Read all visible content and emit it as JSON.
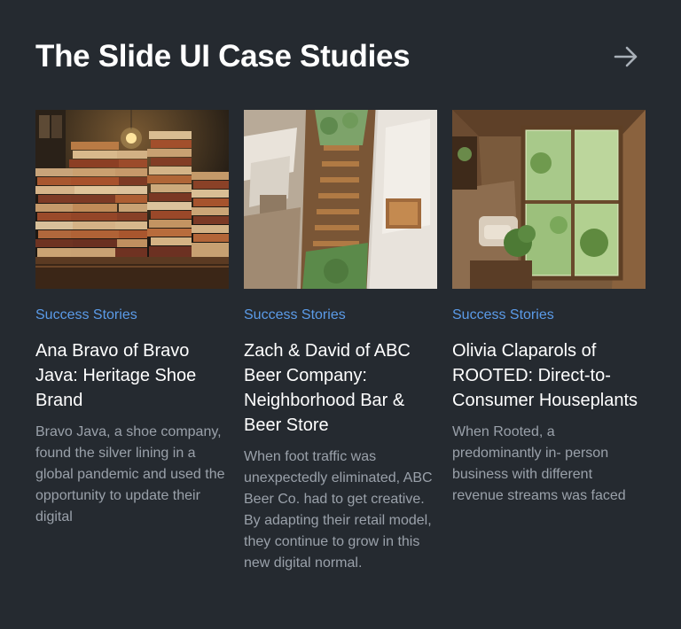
{
  "header": {
    "title": "The Slide UI Case Studies"
  },
  "cards": [
    {
      "image": "books-stack-image",
      "category": "Success Stories",
      "title": "Ana Bravo of Bravo Java: Heritage Shoe Brand",
      "excerpt": "Bravo Java, a shoe company, found the silver lining in a global pandemic and used the opportunity to update their digital"
    },
    {
      "image": "interior-stairs-image",
      "category": "Success Stories",
      "title": "Zach & David of ABC Beer Company: Neighborhood Bar & Beer Store",
      "excerpt": "When foot traffic was unexpectedly eliminated, ABC Beer Co. had to get creative. By adapting their retail model, they continue to grow in this new digital normal."
    },
    {
      "image": "living-room-plants-image",
      "category": "Success Stories",
      "title": "Olivia Claparols of ROOTED: Direct-to-Consumer Houseplants",
      "excerpt": "When Rooted, a predominantly in- person business with different revenue streams was faced"
    }
  ]
}
